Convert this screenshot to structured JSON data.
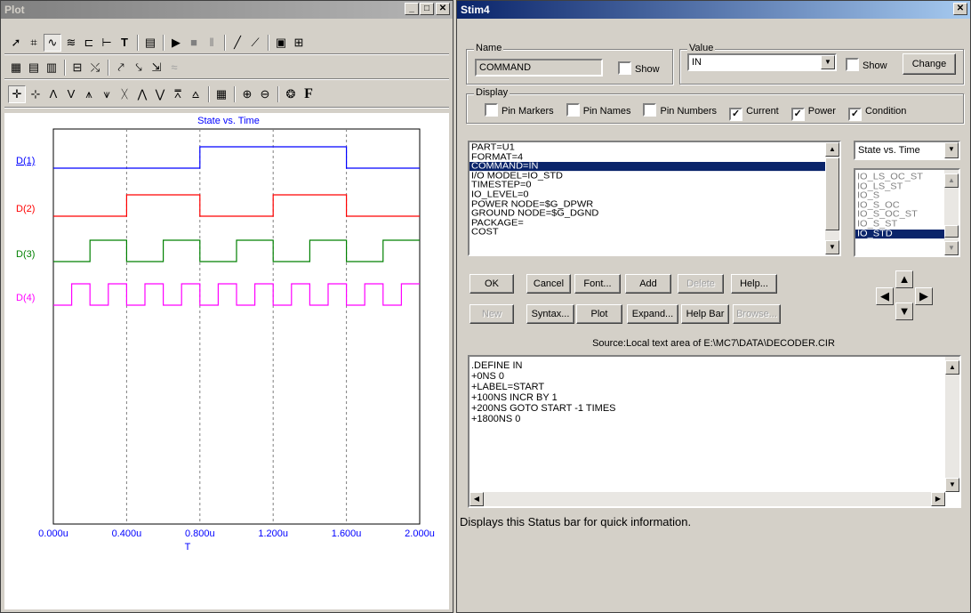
{
  "plot_window": {
    "title": "Plot",
    "chart_title": "State vs. Time",
    "x_axis_label": "T",
    "x_ticks": [
      "0.000u",
      "0.400u",
      "0.800u",
      "1.200u",
      "1.600u",
      "2.000u"
    ],
    "traces": [
      {
        "name": "D(1)",
        "color": "#0000ff"
      },
      {
        "name": "D(2)",
        "color": "#ff0000"
      },
      {
        "name": "D(3)",
        "color": "#008000"
      },
      {
        "name": "D(4)",
        "color": "#ff00ff"
      }
    ]
  },
  "chart_data": {
    "type": "line",
    "title": "State vs. Time",
    "xlabel": "T",
    "xlim": [
      0,
      2.0
    ],
    "x_units": "u",
    "series": [
      {
        "name": "D(1)",
        "steps": [
          [
            0,
            0
          ],
          [
            0.8,
            1
          ],
          [
            1.6,
            0
          ]
        ],
        "end": 2.0
      },
      {
        "name": "D(2)",
        "steps": [
          [
            0,
            0
          ],
          [
            0.4,
            1
          ],
          [
            0.8,
            0
          ],
          [
            1.2,
            1
          ],
          [
            1.6,
            0
          ]
        ],
        "end": 2.0
      },
      {
        "name": "D(3)",
        "steps": [
          [
            0,
            0
          ],
          [
            0.2,
            1
          ],
          [
            0.4,
            0
          ],
          [
            0.6,
            1
          ],
          [
            0.8,
            0
          ],
          [
            1.0,
            1
          ],
          [
            1.2,
            0
          ],
          [
            1.4,
            1
          ],
          [
            1.6,
            0
          ],
          [
            1.8,
            1
          ]
        ],
        "end": 2.0
      },
      {
        "name": "D(4)",
        "steps": [
          [
            0,
            0
          ],
          [
            0.1,
            1
          ],
          [
            0.2,
            0
          ],
          [
            0.3,
            1
          ],
          [
            0.4,
            0
          ],
          [
            0.5,
            1
          ],
          [
            0.6,
            0
          ],
          [
            0.7,
            1
          ],
          [
            0.8,
            0
          ],
          [
            0.9,
            1
          ],
          [
            1.0,
            0
          ],
          [
            1.1,
            1
          ],
          [
            1.2,
            0
          ],
          [
            1.3,
            1
          ],
          [
            1.4,
            0
          ],
          [
            1.5,
            1
          ],
          [
            1.6,
            0
          ],
          [
            1.7,
            1
          ],
          [
            1.8,
            0
          ],
          [
            1.9,
            1
          ]
        ],
        "end": 2.0
      }
    ]
  },
  "stim_window": {
    "title": "Stim4",
    "name_legend": "Name",
    "name_value": "COMMAND",
    "name_show": "Show",
    "value_legend": "Value",
    "value_value": "IN",
    "value_show": "Show",
    "change": "Change",
    "display_legend": "Display",
    "display_checks": [
      {
        "label": "Pin Markers",
        "checked": false
      },
      {
        "label": "Pin Names",
        "checked": false
      },
      {
        "label": "Pin Numbers",
        "checked": false
      },
      {
        "label": "Current",
        "checked": true
      },
      {
        "label": "Power",
        "checked": true
      },
      {
        "label": "Condition",
        "checked": true
      }
    ],
    "attributes": [
      "PART=U1",
      "FORMAT=4",
      "COMMAND=IN",
      "I/O MODEL=IO_STD",
      "TIMESTEP=0",
      "IO_LEVEL=0",
      "POWER NODE=$G_DPWR",
      "GROUND NODE=$G_DGND",
      "PACKAGE=",
      "COST"
    ],
    "selected_attribute": "COMMAND=IN",
    "plot_select": "State vs. Time",
    "models": [
      "IO_LS_OC_ST",
      "IO_LS_ST",
      "IO_S",
      "IO_S_OC",
      "IO_S_OC_ST",
      "IO_S_ST",
      "IO_STD"
    ],
    "selected_model": "IO_STD",
    "buttons_row1": [
      {
        "label": "OK",
        "enabled": true
      },
      {
        "label": "Cancel",
        "enabled": true
      },
      {
        "label": "Font...",
        "enabled": true
      },
      {
        "label": "Add",
        "enabled": true
      },
      {
        "label": "Delete",
        "enabled": false
      },
      {
        "label": "Help...",
        "enabled": true
      }
    ],
    "buttons_row2": [
      {
        "label": "New",
        "enabled": false
      },
      {
        "label": "Syntax...",
        "enabled": true
      },
      {
        "label": "Plot",
        "enabled": true
      },
      {
        "label": "Expand...",
        "enabled": true
      },
      {
        "label": "Help Bar",
        "enabled": true
      },
      {
        "label": "Browse...",
        "enabled": false
      }
    ],
    "source": "Source:Local text area of E:\\MC7\\DATA\\DECODER.CIR",
    "text_lines": [
      ".DEFINE IN",
      "+0NS 0",
      "+LABEL=START",
      "+100NS INCR BY 1",
      "+200NS GOTO START -1 TIMES",
      "+1800NS 0"
    ],
    "status": "Displays this Status bar for quick information."
  }
}
